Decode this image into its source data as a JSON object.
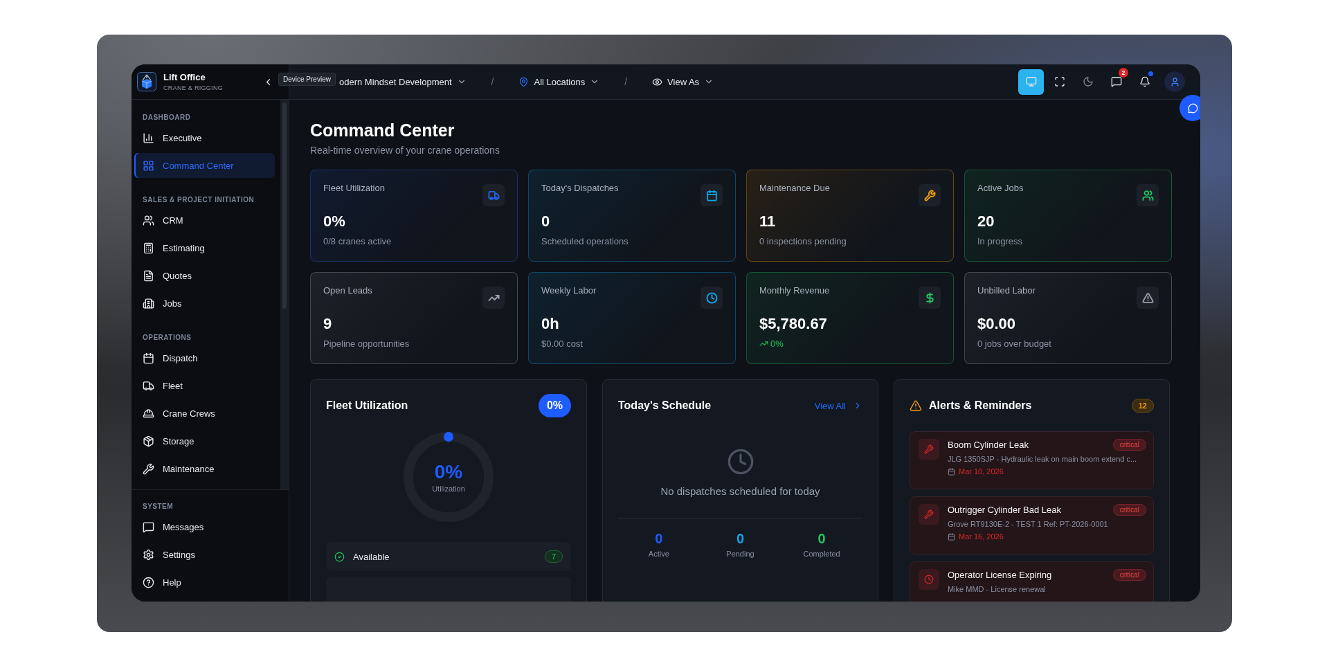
{
  "app": {
    "name": "Lift Office",
    "subtitle": "CRANE & RIGGING"
  },
  "tooltip": "Device Preview",
  "breadcrumbs": [
    {
      "kind": "company",
      "label": "odern Mindset Development"
    },
    {
      "kind": "location",
      "separator": "/",
      "label": "All Locations"
    },
    {
      "kind": "view",
      "separator": "/",
      "label": "View As"
    }
  ],
  "toolbar": [
    {
      "kind": "device",
      "selected": true
    },
    {
      "kind": "fullscreen",
      "selected": false
    },
    {
      "kind": "theme",
      "selected": false
    },
    {
      "kind": "messages",
      "selected": false,
      "badge": "2"
    },
    {
      "kind": "notifications",
      "selected": false,
      "dot": true
    }
  ],
  "sidebar": {
    "sections": [
      {
        "title": "DASHBOARD",
        "items": [
          {
            "kind": "chart",
            "label": "Executive",
            "selected": false
          },
          {
            "kind": "grid",
            "label": "Command Center",
            "selected": true
          }
        ]
      },
      {
        "title": "SALES & PROJECT INITIATION",
        "items": [
          {
            "kind": "users",
            "label": "CRM",
            "selected": false
          },
          {
            "kind": "calculator",
            "label": "Estimating",
            "selected": false
          },
          {
            "kind": "file",
            "label": "Quotes",
            "selected": false
          },
          {
            "kind": "building",
            "label": "Jobs",
            "selected": false
          }
        ]
      },
      {
        "title": "OPERATIONS",
        "items": [
          {
            "kind": "calendar",
            "label": "Dispatch",
            "selected": false
          },
          {
            "kind": "truck",
            "label": "Fleet",
            "selected": false
          },
          {
            "kind": "hardhat",
            "label": "Crane Crews",
            "selected": false
          },
          {
            "kind": "package",
            "label": "Storage",
            "selected": false
          },
          {
            "kind": "wrench",
            "label": "Maintenance",
            "selected": false
          }
        ]
      }
    ],
    "system": {
      "title": "SYSTEM",
      "items": [
        {
          "kind": "message",
          "label": "Messages",
          "selected": false
        },
        {
          "kind": "settings",
          "label": "Settings",
          "selected": false
        },
        {
          "kind": "help",
          "label": "Help",
          "selected": false
        }
      ]
    }
  },
  "page": {
    "title": "Command Center",
    "subtitle": "Real-time overview of your crane operations"
  },
  "stats": [
    {
      "kind": "truck",
      "color": "#2563eb",
      "label": "Fleet Utilization",
      "value": "0%",
      "note": "0/8 cranes active",
      "trend": false
    },
    {
      "kind": "calendar",
      "color": "#0ea5e9",
      "label": "Today's Dispatches",
      "value": "0",
      "note": "Scheduled operations",
      "trend": false
    },
    {
      "kind": "wrench",
      "color": "#f59e0b",
      "label": "Maintenance Due",
      "value": "11",
      "note": "0 inspections pending",
      "trend": false
    },
    {
      "kind": "users",
      "color": "#22c55e",
      "label": "Active Jobs",
      "value": "20",
      "note": "In progress",
      "trend": false
    },
    {
      "kind": "trending",
      "color": "#9ca3af",
      "label": "Open Leads",
      "value": "9",
      "note": "Pipeline opportunities",
      "trend": false
    },
    {
      "kind": "clock",
      "color": "#0ea5e9",
      "label": "Weekly Labor",
      "value": "0h",
      "note": "$0.00 cost",
      "trend": false
    },
    {
      "kind": "dollar",
      "color": "#22c55e",
      "label": "Monthly Revenue",
      "value": "$5,780.67",
      "note": "0%",
      "trend": true
    },
    {
      "kind": "alert",
      "color": "#9ca3af",
      "label": "Unbilled Labor",
      "value": "$0.00",
      "note": "0 jobs over budget",
      "trend": false
    }
  ],
  "fleet_panel": {
    "title": "Fleet Utilization",
    "badge": "0%",
    "gauge": {
      "value": "0%",
      "label": "Utilization",
      "level": 0
    },
    "rows": [
      {
        "label": "Available",
        "count": "7"
      }
    ]
  },
  "schedule": {
    "title": "Today's Schedule",
    "link": "View All",
    "empty": "No dispatches scheduled for today",
    "stats": [
      {
        "value": "0",
        "label": "Active",
        "color": "#1d5cff"
      },
      {
        "value": "0",
        "label": "Pending",
        "color": "#0ea5e9"
      },
      {
        "value": "0",
        "label": "Completed",
        "color": "#22c55e"
      }
    ]
  },
  "alerts": {
    "title": "Alerts & Reminders",
    "count": "12",
    "items": [
      {
        "kind": "wrench",
        "title": "Boom Cylinder Leak",
        "severity": "critical",
        "detail": "JLG 1350SJP - Hydraulic leak on main boom extend c...",
        "date": "Mar 10, 2026"
      },
      {
        "kind": "wrench",
        "title": "Outrigger Cylinder Bad Leak",
        "severity": "critical",
        "detail": "Grove RT9130E-2 - TEST 1 Ref: PT-2026-0001",
        "date": "Mar 16, 2026"
      },
      {
        "kind": "clock",
        "title": "Operator License Expiring",
        "severity": "critical",
        "detail": "Mike MMD - License renewal"
      }
    ]
  }
}
